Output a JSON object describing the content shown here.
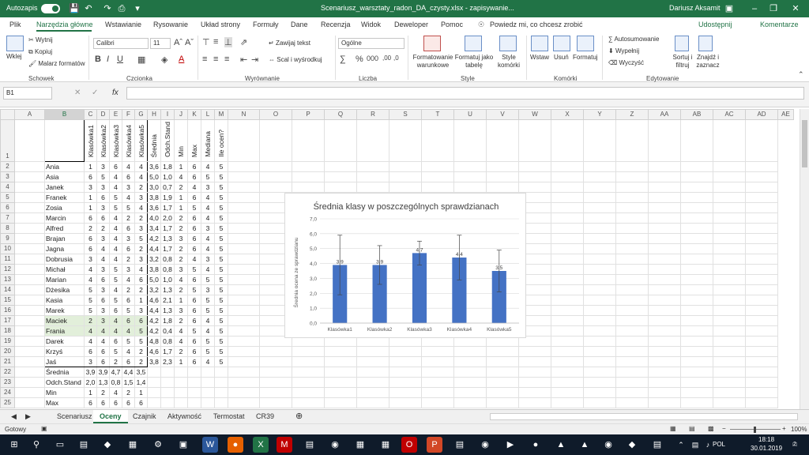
{
  "titlebar": {
    "autosave": "Autozapis",
    "filename": "Scenariusz_warsztaty_radon_DA_czysty.xlsx - zapisywanie...",
    "user": "Dariusz Aksamit"
  },
  "tabs": [
    "Plik",
    "Narzędzia główne",
    "Wstawianie",
    "Rysowanie",
    "Układ strony",
    "Formuły",
    "Dane",
    "Recenzja",
    "Widok",
    "Deweloper",
    "Pomoc"
  ],
  "tell_me": "Powiedz mi, co chcesz zrobić",
  "share": "Udostępnij",
  "comments": "Komentarze",
  "ribbon": {
    "paste": "Wklej",
    "cut": "Wytnij",
    "copy": "Kopiuj",
    "format_painter": "Malarz formatów",
    "group_clipboard": "Schowek",
    "font_name": "Calibri",
    "font_size": "11",
    "group_font": "Czcionka",
    "wrap_text": "Zawijaj tekst",
    "merge_center": "Scal i wyśrodkuj",
    "group_alignment": "Wyrównanie",
    "number_format": "Ogólne",
    "group_number": "Liczba",
    "cond_format": "Formatowanie warunkowe",
    "format_table": "Formatuj jako tabelę",
    "cell_styles": "Style komórki",
    "group_styles": "Style",
    "insert": "Wstaw",
    "delete": "Usuń",
    "format": "Formatuj",
    "group_cells": "Komórki",
    "autosum": "Autosumowanie",
    "fill": "Wypełnij",
    "clear": "Wyczyść",
    "sort_filter": "Sortuj i filtruj",
    "find_select": "Znajdź i zaznacz",
    "group_editing": "Edytowanie"
  },
  "namebox": "B1",
  "columns": [
    "A",
    "B",
    "C",
    "D",
    "E",
    "F",
    "G",
    "H",
    "I",
    "J",
    "K",
    "L",
    "M",
    "N",
    "O",
    "P",
    "Q",
    "R",
    "S",
    "T",
    "U",
    "V",
    "W",
    "X",
    "Y",
    "Z",
    "AA",
    "AB",
    "AC",
    "AD",
    "AE"
  ],
  "header_labels": [
    "Klasówka1",
    "Klasówka2",
    "Klasówka3",
    "Klasówka4",
    "Klasówka5",
    "Średnia",
    "Odch.Stand",
    "Min",
    "Max",
    "Mediana",
    "Ile ocen?"
  ],
  "students": [
    {
      "name": "Ania",
      "v": [
        "1",
        "3",
        "6",
        "4",
        "4",
        "3,6",
        "1,8",
        "1",
        "6",
        "4",
        "5"
      ]
    },
    {
      "name": "Asia",
      "v": [
        "6",
        "5",
        "4",
        "6",
        "4",
        "5,0",
        "1,0",
        "4",
        "6",
        "5",
        "5"
      ]
    },
    {
      "name": "Janek",
      "v": [
        "3",
        "3",
        "4",
        "3",
        "2",
        "3,0",
        "0,7",
        "2",
        "4",
        "3",
        "5"
      ]
    },
    {
      "name": "Franek",
      "v": [
        "1",
        "6",
        "5",
        "4",
        "3",
        "3,8",
        "1,9",
        "1",
        "6",
        "4",
        "5"
      ]
    },
    {
      "name": "Zosia",
      "v": [
        "1",
        "3",
        "5",
        "5",
        "4",
        "3,6",
        "1,7",
        "1",
        "5",
        "4",
        "5"
      ]
    },
    {
      "name": "Marcin",
      "v": [
        "6",
        "6",
        "4",
        "2",
        "2",
        "4,0",
        "2,0",
        "2",
        "6",
        "4",
        "5"
      ]
    },
    {
      "name": "Alfred",
      "v": [
        "2",
        "2",
        "4",
        "6",
        "3",
        "3,4",
        "1,7",
        "2",
        "6",
        "3",
        "5"
      ]
    },
    {
      "name": "Brajan",
      "v": [
        "6",
        "3",
        "4",
        "3",
        "5",
        "4,2",
        "1,3",
        "3",
        "6",
        "4",
        "5"
      ]
    },
    {
      "name": "Jagna",
      "v": [
        "6",
        "4",
        "4",
        "6",
        "2",
        "4,4",
        "1,7",
        "2",
        "6",
        "4",
        "5"
      ]
    },
    {
      "name": "Dobrusia",
      "v": [
        "3",
        "4",
        "4",
        "2",
        "3",
        "3,2",
        "0,8",
        "2",
        "4",
        "3",
        "5"
      ]
    },
    {
      "name": "Michał",
      "v": [
        "4",
        "3",
        "5",
        "3",
        "4",
        "3,8",
        "0,8",
        "3",
        "5",
        "4",
        "5"
      ]
    },
    {
      "name": "Marian",
      "v": [
        "4",
        "6",
        "5",
        "4",
        "6",
        "5,0",
        "1,0",
        "4",
        "6",
        "5",
        "5"
      ]
    },
    {
      "name": "Dżesika",
      "v": [
        "5",
        "3",
        "4",
        "2",
        "2",
        "3,2",
        "1,3",
        "2",
        "5",
        "3",
        "5"
      ]
    },
    {
      "name": "Kasia",
      "v": [
        "5",
        "6",
        "5",
        "6",
        "1",
        "4,6",
        "2,1",
        "1",
        "6",
        "5",
        "5"
      ]
    },
    {
      "name": "Marek",
      "v": [
        "5",
        "3",
        "6",
        "5",
        "3",
        "4,4",
        "1,3",
        "3",
        "6",
        "5",
        "5"
      ]
    },
    {
      "name": "Maciek",
      "v": [
        "2",
        "3",
        "4",
        "6",
        "6",
        "4,2",
        "1,8",
        "2",
        "6",
        "4",
        "5"
      ]
    },
    {
      "name": "Frania",
      "v": [
        "4",
        "4",
        "4",
        "4",
        "5",
        "4,2",
        "0,4",
        "4",
        "5",
        "4",
        "5"
      ]
    },
    {
      "name": "Darek",
      "v": [
        "4",
        "4",
        "6",
        "5",
        "5",
        "4,8",
        "0,8",
        "4",
        "6",
        "5",
        "5"
      ]
    },
    {
      "name": "Krzyś",
      "v": [
        "6",
        "6",
        "5",
        "4",
        "2",
        "4,6",
        "1,7",
        "2",
        "6",
        "5",
        "5"
      ]
    },
    {
      "name": "Jaś",
      "v": [
        "3",
        "6",
        "2",
        "6",
        "2",
        "3,8",
        "2,3",
        "1",
        "6",
        "4",
        "5"
      ]
    }
  ],
  "summary": [
    {
      "label": "Średnia",
      "v": [
        "3,9",
        "3,9",
        "4,7",
        "4,4",
        "3,5"
      ]
    },
    {
      "label": "Odch.Stand",
      "v": [
        "2,0",
        "1,3",
        "0,8",
        "1,5",
        "1,4"
      ]
    },
    {
      "label": "Min",
      "v": [
        "1",
        "2",
        "4",
        "2",
        "1"
      ]
    },
    {
      "label": "Max",
      "v": [
        "6",
        "6",
        "6",
        "6",
        "6"
      ]
    }
  ],
  "chart_data": {
    "type": "bar",
    "title": "Średnia klasy w poszczególnych sprawdzianach",
    "xlabel": "",
    "ylabel": "Średnia ocena ze sprawdzianu",
    "categories": [
      "Klasówka1",
      "Klasówka2",
      "Klasówka3",
      "Klasówka4",
      "Klasówka5"
    ],
    "values": [
      3.9,
      3.9,
      4.7,
      4.4,
      3.5
    ],
    "value_labels": [
      "3,9",
      "3,9",
      "4,7",
      "4,4",
      "3,5"
    ],
    "error_bars": [
      2.0,
      1.3,
      0.8,
      1.5,
      1.4
    ],
    "ylim": [
      0,
      7
    ],
    "yticks": [
      "0,0",
      "1,0",
      "2,0",
      "3,0",
      "4,0",
      "5,0",
      "6,0",
      "7,0"
    ],
    "grid": true,
    "bar_color": "#4472c4"
  },
  "sheet_tabs": [
    "Scenariusz",
    "Oceny",
    "Czajnik",
    "Aktywność",
    "Termostat",
    "CR39"
  ],
  "active_sheet": "Oceny",
  "status": {
    "ready": "Gotowy",
    "zoom": "100%"
  },
  "taskbar": {
    "lang": "POL",
    "time": "18:18",
    "date": "30.01.2019",
    "notif": "2"
  }
}
